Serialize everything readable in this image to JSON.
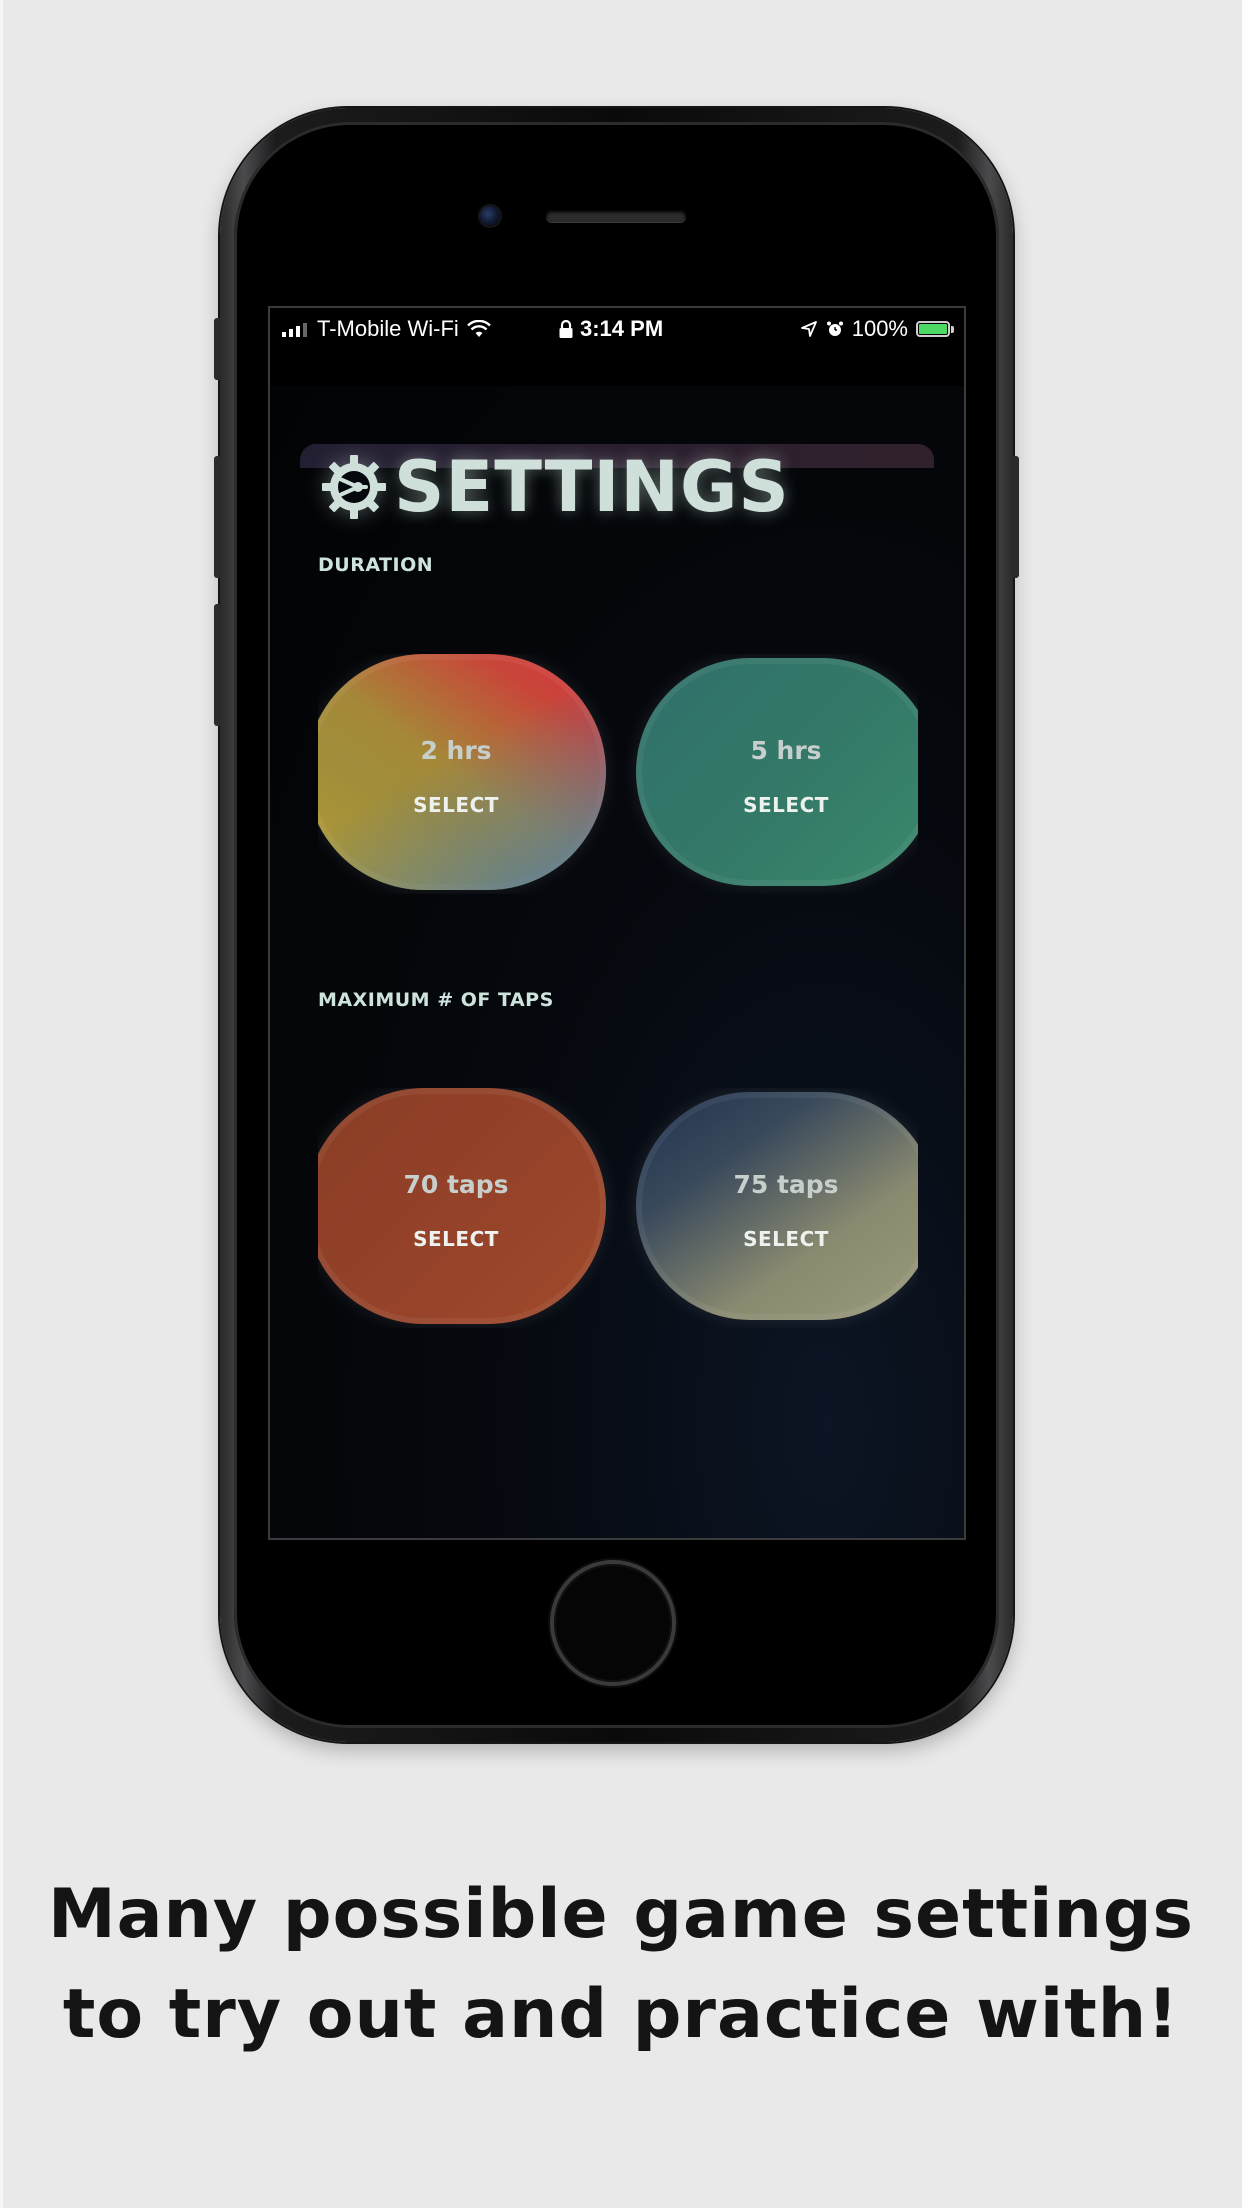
{
  "status_bar": {
    "carrier": "T-Mobile Wi-Fi",
    "time": "3:14 PM",
    "battery": "100%",
    "icons": [
      "signal-icon",
      "wifi-icon",
      "lock-icon",
      "location-icon",
      "alarm-icon",
      "battery-charging-icon"
    ]
  },
  "settings": {
    "title": "SETTINGS",
    "title_icon": "gear-icon",
    "duration": {
      "label": "DURATION",
      "options": [
        {
          "value": "2 hrs",
          "action": "SELECT",
          "colors": [
            "#d8343f",
            "#a08d3a",
            "#4a7ab0"
          ]
        },
        {
          "value": "5 hrs",
          "action": "SELECT",
          "colors": [
            "#327068",
            "#3a8a6c"
          ]
        }
      ]
    },
    "taps": {
      "label": "MAXIMUM # OF TAPS",
      "options": [
        {
          "value": "70 taps",
          "action": "SELECT",
          "colors": [
            "#8e3f24",
            "#a04a2a"
          ]
        },
        {
          "value": "75 taps",
          "action": "SELECT",
          "colors": [
            "#1f304d",
            "#9a9a7c"
          ]
        }
      ]
    }
  },
  "caption": {
    "line1": "Many possible game settings",
    "line2": "to try out and practice with!"
  }
}
